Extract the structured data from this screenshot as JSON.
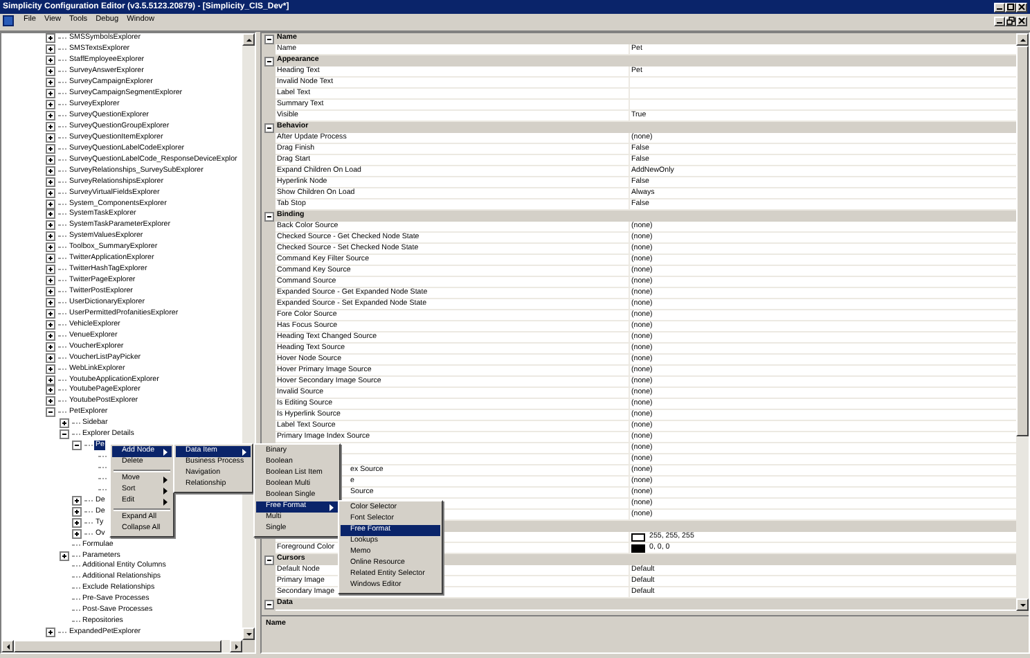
{
  "window": {
    "title": "Simplicity Configuration Editor (v3.5.5123.20879) - [Simplicity_CIS_Dev*]"
  },
  "menu_bar": [
    "File",
    "View",
    "Tools",
    "Debug",
    "Window"
  ],
  "tree": [
    {
      "label": "SMSSymbolsExplorer",
      "expanded": false,
      "selected": false
    },
    {
      "label": "SMSTextsExplorer",
      "expanded": false,
      "selected": false
    },
    {
      "label": "StaffEmployeeExplorer",
      "expanded": false,
      "selected": false
    },
    {
      "label": "SurveyAnswerExplorer",
      "expanded": false,
      "selected": false
    },
    {
      "label": "SurveyCampaignExplorer",
      "expanded": false,
      "selected": false
    },
    {
      "label": "SurveyCampaignSegmentExplorer",
      "expanded": false,
      "selected": false
    },
    {
      "label": "SurveyExplorer",
      "expanded": false,
      "selected": false
    },
    {
      "label": "SurveyQuestionExplorer",
      "expanded": false,
      "selected": false
    },
    {
      "label": "SurveyQuestionGroupExplorer",
      "expanded": false,
      "selected": false
    },
    {
      "label": "SurveyQuestionItemExplorer",
      "expanded": false,
      "selected": false
    },
    {
      "label": "SurveyQuestionLabelCodeExplorer",
      "expanded": false,
      "selected": false
    },
    {
      "label": "SurveyQuestionLabelCode_ResponseDeviceExplor",
      "expanded": false,
      "selected": false
    },
    {
      "label": "SurveyRelationships_SurveySubExplorer",
      "expanded": false,
      "selected": false
    },
    {
      "label": "SurveyRelationshipsExplorer",
      "expanded": false,
      "selected": false
    },
    {
      "label": "SurveyVirtualFieldsExplorer",
      "expanded": false,
      "selected": false
    },
    {
      "label": "System_ComponentsExplorer",
      "expanded": false,
      "selected": false
    },
    {
      "label": "SystemTaskExplorer",
      "expanded": false,
      "selected": false
    },
    {
      "label": "SystemTaskParameterExplorer",
      "expanded": false,
      "selected": false
    },
    {
      "label": "SystemValuesExplorer",
      "expanded": false,
      "selected": false
    },
    {
      "label": "Toolbox_SummaryExplorer",
      "expanded": false,
      "selected": false
    },
    {
      "label": "TwitterApplicationExplorer",
      "expanded": false,
      "selected": false
    },
    {
      "label": "TwitterHashTagExplorer",
      "expanded": false,
      "selected": false
    },
    {
      "label": "TwitterPageExplorer",
      "expanded": false,
      "selected": false
    },
    {
      "label": "TwitterPostExplorer",
      "expanded": false,
      "selected": false
    },
    {
      "label": "UserDictionaryExplorer",
      "expanded": false,
      "selected": false
    },
    {
      "label": "UserPermittedProfanitiesExplorer",
      "expanded": false,
      "selected": false
    },
    {
      "label": "VehicleExplorer",
      "expanded": false,
      "selected": false
    },
    {
      "label": "VenueExplorer",
      "expanded": false,
      "selected": false
    },
    {
      "label": "VoucherExplorer",
      "expanded": false,
      "selected": false
    },
    {
      "label": "VoucherListPayPicker",
      "expanded": false,
      "selected": false
    },
    {
      "label": "WebLinkExplorer",
      "expanded": false,
      "selected": false
    },
    {
      "label": "YoutubeApplicationExplorer",
      "expanded": false,
      "selected": false
    },
    {
      "label": "YoutubePageExplorer",
      "expanded": false,
      "selected": false
    },
    {
      "label": "YoutubePostExplorer",
      "expanded": false,
      "selected": false
    },
    {
      "label": "PetExplorer",
      "expanded": true,
      "selected": false,
      "children": [
        {
          "label": "Sidebar",
          "expanded": false,
          "selected": false
        },
        {
          "label": "Explorer Details",
          "expanded": true,
          "selected": false,
          "children": [
            {
              "label": "Pe",
              "expanded": true,
              "selected": true,
              "children": [
                {
                  "selected": false
                },
                {
                  "selected": false
                },
                {
                  "selected": false
                },
                {
                  "selected": false
                }
              ]
            },
            {
              "label": "De",
              "expanded": false,
              "selected": false
            },
            {
              "label": "De",
              "expanded": false,
              "selected": false
            },
            {
              "label": "Ty",
              "expanded": false,
              "selected": false
            },
            {
              "label": "Ov",
              "expanded": false,
              "selected": false
            }
          ]
        },
        {
          "label": "Formulae",
          "selected": false
        },
        {
          "label": "Parameters",
          "expanded": false,
          "selected": false
        },
        {
          "label": "Additional Entity Columns",
          "selected": false
        },
        {
          "label": "Additional Relationships",
          "selected": false
        },
        {
          "label": "Exclude Relationships",
          "selected": false
        },
        {
          "label": "Pre-Save Processes",
          "selected": false
        },
        {
          "label": "Post-Save Processes",
          "selected": false
        },
        {
          "label": "Repositories",
          "selected": false
        }
      ]
    },
    {
      "label": "ExpandedPetExplorer",
      "expanded": false,
      "selected": false
    }
  ],
  "property_grid": {
    "rows": [
      {
        "kind": "category",
        "label": "Name",
        "expanded": true
      },
      {
        "kind": "property",
        "label": "Name",
        "value": "Pet"
      },
      {
        "kind": "category",
        "label": "Appearance",
        "expanded": true
      },
      {
        "kind": "property",
        "label": "Heading Text",
        "value": "Pet"
      },
      {
        "kind": "property",
        "label": "Invalid Node Text"
      },
      {
        "kind": "property",
        "label": "Label Text"
      },
      {
        "kind": "property",
        "label": "Summary Text"
      },
      {
        "kind": "property",
        "label": "Visible",
        "value": "True"
      },
      {
        "kind": "category",
        "label": "Behavior",
        "expanded": true
      },
      {
        "kind": "property",
        "label": "After Update Process",
        "value": "(none)"
      },
      {
        "kind": "property",
        "label": "Drag Finish",
        "value": "False"
      },
      {
        "kind": "property",
        "label": "Drag Start",
        "value": "False"
      },
      {
        "kind": "property",
        "label": "Expand Children On Load",
        "value": "AddNewOnly"
      },
      {
        "kind": "property",
        "label": "Hyperlink Node",
        "value": "False"
      },
      {
        "kind": "property",
        "label": "Show Children On Load",
        "value": "Always"
      },
      {
        "kind": "property",
        "label": "Tab Stop",
        "value": "False"
      },
      {
        "kind": "category",
        "label": "Binding",
        "expanded": true
      },
      {
        "kind": "property",
        "label": "Back Color Source",
        "value": "(none)"
      },
      {
        "kind": "property",
        "label": "Checked Source - Get Checked Node State",
        "value": "(none)"
      },
      {
        "kind": "property",
        "label": "Checked Source - Set Checked Node State",
        "value": "(none)"
      },
      {
        "kind": "property",
        "label": "Command Key Filter Source",
        "value": "(none)"
      },
      {
        "kind": "property",
        "label": "Command Key Source",
        "value": "(none)"
      },
      {
        "kind": "property",
        "label": "Command Source",
        "value": "(none)"
      },
      {
        "kind": "property",
        "label": "Expanded Source - Get Expanded Node State",
        "value": "(none)"
      },
      {
        "kind": "property",
        "label": "Expanded Source - Set Expanded Node State",
        "value": "(none)"
      },
      {
        "kind": "property",
        "label": "Fore Color Source",
        "value": "(none)"
      },
      {
        "kind": "property",
        "label": "Has Focus Source",
        "value": "(none)"
      },
      {
        "kind": "property",
        "label": "Heading Text Changed Source",
        "value": "(none)"
      },
      {
        "kind": "property",
        "label": "Heading Text Source",
        "value": "(none)"
      },
      {
        "kind": "property",
        "label": "Hover Node Source",
        "value": "(none)"
      },
      {
        "kind": "property",
        "label": "Hover Primary Image Source",
        "value": "(none)"
      },
      {
        "kind": "property",
        "label": "Hover Secondary Image Source",
        "value": "(none)"
      },
      {
        "kind": "property",
        "label": "Invalid Source",
        "value": "(none)"
      },
      {
        "kind": "property",
        "label": "Is Editing Source",
        "value": "(none)"
      },
      {
        "kind": "property",
        "label": "Is Hyperlink Source",
        "value": "(none)"
      },
      {
        "kind": "property",
        "label": "Label Text Source",
        "value": "(none)"
      },
      {
        "kind": "property",
        "label": "Primary Image Index Source",
        "value": "(none)"
      },
      {
        "kind": "property",
        "value": "(none)"
      },
      {
        "kind": "property",
        "value": "(none)"
      },
      {
        "kind": "property",
        "label": "ex Source",
        "covered": true,
        "value": "(none)"
      },
      {
        "kind": "property",
        "label": "e",
        "covered": true,
        "value": "(none)"
      },
      {
        "kind": "property",
        "label": "Source",
        "covered": true,
        "value": "(none)"
      },
      {
        "kind": "property",
        "value": "(none)"
      },
      {
        "kind": "property",
        "value": "(none)"
      },
      {
        "kind": "category"
      },
      {
        "kind": "property",
        "value": "255, 255, 255",
        "color": "#ffffff"
      },
      {
        "kind": "property",
        "label": "Foreground Color",
        "value": "0, 0, 0",
        "color": "#000000"
      },
      {
        "kind": "category",
        "label": "Cursors",
        "expanded": true
      },
      {
        "kind": "property",
        "label": "Default Node",
        "value": "Default"
      },
      {
        "kind": "property",
        "label": "Primary Image",
        "value": "Default"
      },
      {
        "kind": "property",
        "label": "Secondary Image",
        "value": "Default"
      },
      {
        "kind": "category",
        "label": "Data",
        "expanded": true
      }
    ]
  },
  "description": {
    "title": "Name"
  },
  "context_menus": [
    {
      "items": [
        {
          "kind": "item",
          "label": "Add Node",
          "submenu": true,
          "selected": true
        },
        {
          "kind": "item",
          "label": "Delete",
          "submenu": false,
          "selected": false
        },
        {
          "kind": "separator"
        },
        {
          "kind": "item",
          "label": "Move",
          "submenu": true,
          "selected": false
        },
        {
          "kind": "item",
          "label": "Sort",
          "submenu": true,
          "selected": false
        },
        {
          "kind": "item",
          "label": "Edit",
          "submenu": true,
          "selected": false
        },
        {
          "kind": "separator"
        },
        {
          "kind": "item",
          "label": "Expand All",
          "submenu": false,
          "selected": false
        },
        {
          "kind": "item",
          "label": "Collapse All",
          "submenu": false,
          "selected": false
        }
      ]
    },
    {
      "items": [
        {
          "kind": "item",
          "label": "Data Item",
          "submenu": true,
          "selected": true
        },
        {
          "kind": "item",
          "label": "Business Process",
          "submenu": false,
          "selected": false
        },
        {
          "kind": "item",
          "label": "Navigation",
          "submenu": false,
          "selected": false
        },
        {
          "kind": "item",
          "label": "Relationship",
          "submenu": false,
          "selected": false
        }
      ]
    },
    {
      "items": [
        {
          "kind": "item",
          "label": "Binary",
          "submenu": false,
          "selected": false
        },
        {
          "kind": "item",
          "label": "Boolean",
          "submenu": false,
          "selected": false
        },
        {
          "kind": "item",
          "label": "Boolean List Item",
          "submenu": false,
          "selected": false
        },
        {
          "kind": "item",
          "label": "Boolean Multi",
          "submenu": false,
          "selected": false
        },
        {
          "kind": "item",
          "label": "Boolean Single",
          "submenu": false,
          "selected": false
        },
        {
          "kind": "item",
          "label": "Free Format",
          "submenu": true,
          "selected": true
        },
        {
          "kind": "item",
          "label": "Multi",
          "submenu": false,
          "selected": false
        },
        {
          "kind": "item",
          "label": "Single",
          "submenu": false,
          "selected": false
        }
      ]
    },
    {
      "items": [
        {
          "kind": "item",
          "label": "Color Selector",
          "submenu": false,
          "selected": false
        },
        {
          "kind": "item",
          "label": "Font Selector",
          "submenu": false,
          "selected": false
        },
        {
          "kind": "item",
          "label": "Free Format",
          "submenu": false,
          "selected": true
        },
        {
          "kind": "item",
          "label": "Lookups",
          "submenu": false,
          "selected": false
        },
        {
          "kind": "item",
          "label": "Memo",
          "submenu": false,
          "selected": false
        },
        {
          "kind": "item",
          "label": "Online Resource",
          "submenu": false,
          "selected": false
        },
        {
          "kind": "item",
          "label": "Related Entity Selector",
          "submenu": false,
          "selected": false
        },
        {
          "kind": "item",
          "label": "Windows Editor",
          "submenu": false,
          "selected": false
        }
      ]
    }
  ]
}
